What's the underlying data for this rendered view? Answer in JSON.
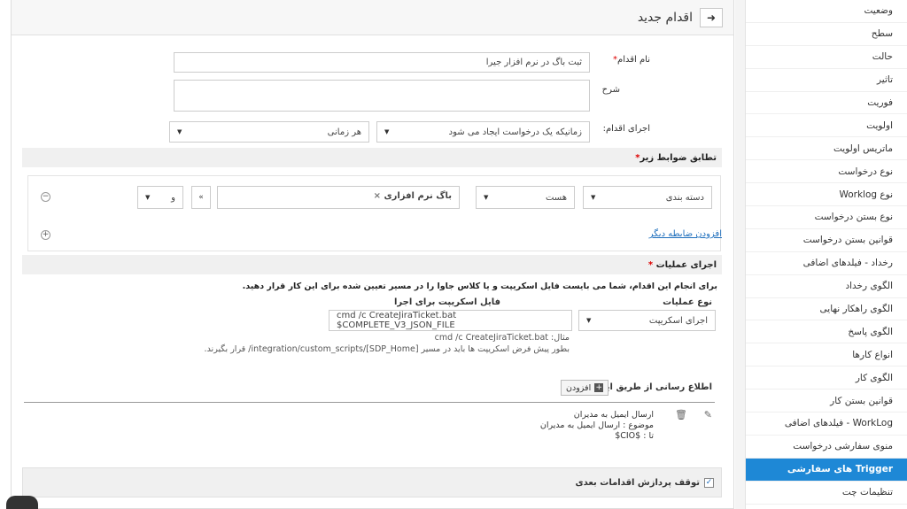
{
  "sidebar": {
    "items": [
      {
        "label": "وضعیت"
      },
      {
        "label": "سطح"
      },
      {
        "label": "حالت"
      },
      {
        "label": "تاثیر"
      },
      {
        "label": "فوریت"
      },
      {
        "label": "اولویت"
      },
      {
        "label": "ماتریس اولویت"
      },
      {
        "label": "نوع درخواست"
      },
      {
        "label": "نوع Worklog"
      },
      {
        "label": "نوع بستن درخواست"
      },
      {
        "label": "قوانین بستن درخواست"
      },
      {
        "label": "رخداد - فیلدهای اضافی"
      },
      {
        "label": "الگوی رخداد"
      },
      {
        "label": "الگوی راهکار نهایی"
      },
      {
        "label": "الگوی پاسخ"
      },
      {
        "label": "انواع کارها"
      },
      {
        "label": "الگوی کار"
      },
      {
        "label": "قوانین بستن کار"
      },
      {
        "label": "WorkLog - فیلدهای اضافی"
      },
      {
        "label": "منوی سفارشی درخواست"
      },
      {
        "label": "Trigger های سفارشی",
        "active": true
      },
      {
        "label": "تنظیمات چت"
      }
    ]
  },
  "header": {
    "title": "اقدام جدید",
    "back_icon": "arrow-right-icon"
  },
  "form": {
    "name_label": "نام اقدام",
    "name_required": "*",
    "name_value": "ثبت باگ در نرم افزار جیرا",
    "desc_label": "شرح",
    "exec_label": "اجرای اقدام:",
    "exec_when_value": "زمانیکه یک درخواست ایجاد می شود",
    "exec_time_value": "هر زمانی"
  },
  "criteria": {
    "title": "تطابق ضوابط زیر",
    "required": "*",
    "field_value": "دسته بندی",
    "operator_value": "هست",
    "tag_value": "باگ نرم افزاری",
    "tag_remove": "×",
    "conj_value": "و",
    "minus": "−",
    "plus": "+",
    "add_link": "افزودن ضابطه دیگر"
  },
  "actions": {
    "title": "اجرای عملیات",
    "required": "*",
    "note": "برای انجام این اقدام، شما می بایست فایل اسکریپت و یا کلاس جاوا را در مسیر تعیین شده برای این کار قرار دهید.",
    "op_type_label": "نوع عملیات",
    "op_type_value": "اجرای اسکریپت",
    "script_label": "فایل اسکریپت برای اجرا",
    "script_value": "cmd /c CreateJiraTicket.bat $COMPLETE_V3_JSON_FILE",
    "example_line1": "مثال: cmd /c CreateJiraTicket.bat",
    "example_line2": "بطور پیش فرض اسکریپت ها باید در مسیر [SDP_Home]/integration/custom_scripts/ قرار بگیرند."
  },
  "email": {
    "title": "اطلاع رسانی از طریق ایمیل",
    "add_label": "افزودن",
    "item_title": "ارسال ایمیل به مدیران",
    "item_subject": "موضوع : ارسال ایمیل به مدیران",
    "item_to": "تا : $CIO$"
  },
  "stop": {
    "label": "توقف پردازش اقدامات بعدی",
    "checked": true
  }
}
